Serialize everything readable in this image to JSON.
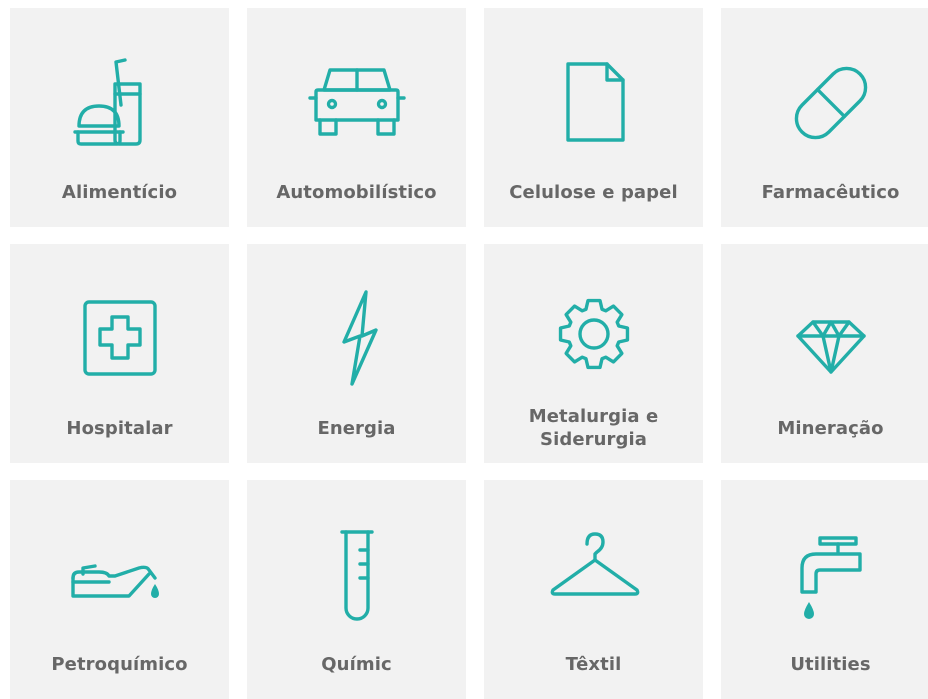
{
  "accent_color": "#22aea8",
  "tile_color": "#f2f2f2",
  "label_color": "#676767",
  "tiles": [
    {
      "label": "Alimentício",
      "icon": "food-drink-icon"
    },
    {
      "label": "Automobilístico",
      "icon": "car-icon"
    },
    {
      "label": "Celulose e papel",
      "icon": "paper-sheet-icon"
    },
    {
      "label": "Farmacêutico",
      "icon": "pill-capsule-icon"
    },
    {
      "label": "Hospitalar",
      "icon": "medical-cross-icon"
    },
    {
      "label": "Energia",
      "icon": "lightning-bolt-icon"
    },
    {
      "label": "Metalurgia e Siderurgia",
      "icon": "gear-icon"
    },
    {
      "label": "Mineração",
      "icon": "diamond-icon"
    },
    {
      "label": "Petroquímico",
      "icon": "oil-can-icon"
    },
    {
      "label": "Químic",
      "icon": "test-tube-icon"
    },
    {
      "label": "Têxtil",
      "icon": "hanger-icon"
    },
    {
      "label": "Utilities",
      "icon": "water-faucet-icon"
    }
  ]
}
